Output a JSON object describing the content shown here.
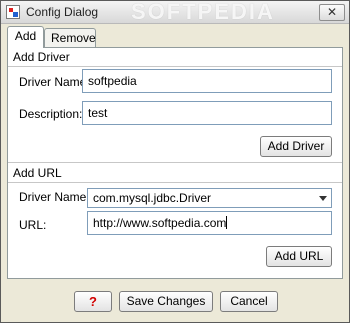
{
  "window": {
    "title": "Config Dialog",
    "watermark": "SOFTPEDIA",
    "close_glyph": "✕",
    "icon": "app-icon"
  },
  "tabs": [
    {
      "label": "Add",
      "active": true
    },
    {
      "label": "Remove",
      "active": false
    }
  ],
  "add_driver": {
    "group_title": "Add Driver",
    "driver_name_label": "Driver Name:",
    "driver_name_value": "softpedia",
    "description_label": "Description:",
    "description_value": "test",
    "add_button": "Add Driver"
  },
  "add_url": {
    "group_title": "Add URL",
    "driver_name_label": "Driver Name:",
    "driver_selected": "com.mysql.jdbc.Driver",
    "url_label": "URL:",
    "url_value": "http://www.softpedia.com",
    "add_button": "Add URL"
  },
  "footer": {
    "help_glyph": "?",
    "save_button": "Save Changes",
    "cancel_button": "Cancel"
  },
  "colors": {
    "help_icon": "#d20000",
    "field_border": "#7f9db9"
  }
}
